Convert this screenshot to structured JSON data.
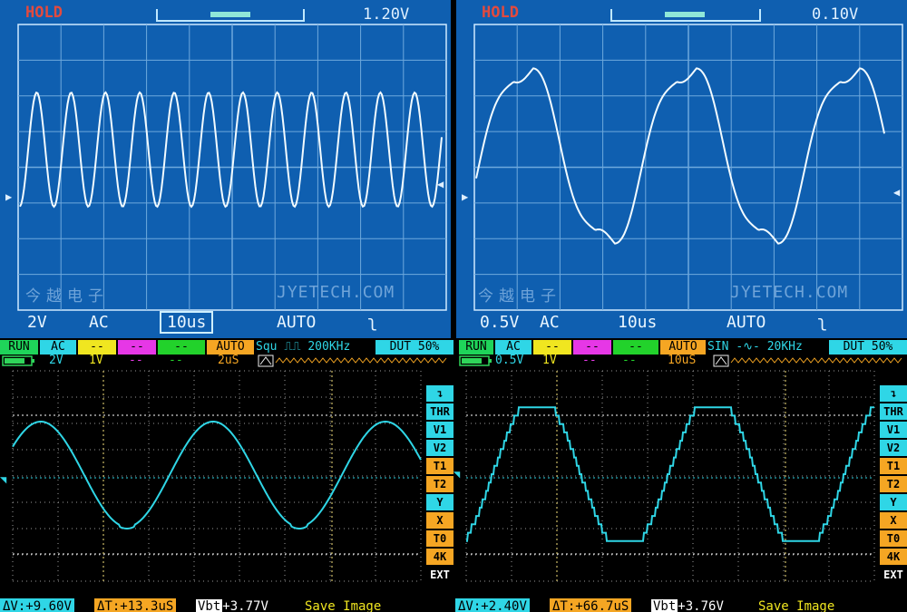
{
  "top_left": {
    "hold": "HOLD",
    "voltage": "1.20V",
    "volts_div": "2V",
    "coupling": "AC",
    "timebase": "10us",
    "mode": "AUTO",
    "trigger_icon": "falling-edge-icon",
    "watermark": "JYETECH.COM",
    "chinese_mark": "今越电子"
  },
  "top_right": {
    "hold": "HOLD",
    "voltage": "0.10V",
    "volts_div": "0.5V",
    "coupling": "AC",
    "timebase": "10us",
    "mode": "AUTO",
    "trigger_icon": "falling-edge-icon",
    "watermark": "JYETECH.COM",
    "chinese_mark": "今越电子"
  },
  "bottom_left": {
    "status": [
      "RUN",
      "AC",
      "--",
      "--",
      "--",
      "AUTO"
    ],
    "generator": "Squ",
    "frequency": "200KHz",
    "duty": "DUT 50%",
    "ch_volt": "2V",
    "ch2_volt": "1V",
    "dash1": "--",
    "dash2": "--",
    "timebase": "2uS",
    "side_buttons": [
      "THR",
      "V1",
      "V2",
      "T1",
      "T2",
      "Y",
      "X",
      "T0",
      "4K",
      "EXT"
    ],
    "delta_v": "+9.60V",
    "delta_t": "+13.3uS",
    "vbt": "+3.77V",
    "save": "Save Image"
  },
  "bottom_right": {
    "status": [
      "RUN",
      "AC",
      "--",
      "--",
      "--",
      "AUTO"
    ],
    "generator": "SIN",
    "frequency": "20KHz",
    "duty": "DUT 50%",
    "ch_volt": "0.5V",
    "ch2_volt": "1V",
    "dash1": "--",
    "dash2": "--",
    "timebase": "10uS",
    "side_buttons": [
      "THR",
      "V1",
      "V2",
      "T1",
      "T2",
      "Y",
      "X",
      "T0",
      "4K",
      "EXT"
    ],
    "delta_v": "+2.40V",
    "delta_t": "+66.7uS",
    "vbt": "+3.76V",
    "save": "Save Image"
  },
  "labels": {
    "delta_v_prefix": "ΔV:",
    "delta_t_prefix": "ΔT:",
    "vbt_prefix": "Vbt"
  },
  "colors": {
    "lcd_bg": "#0f5fb0",
    "trace_lcd": "#f2fbff",
    "trace_tft": "#2fd6e6",
    "status_orange": "#f5a623"
  }
}
